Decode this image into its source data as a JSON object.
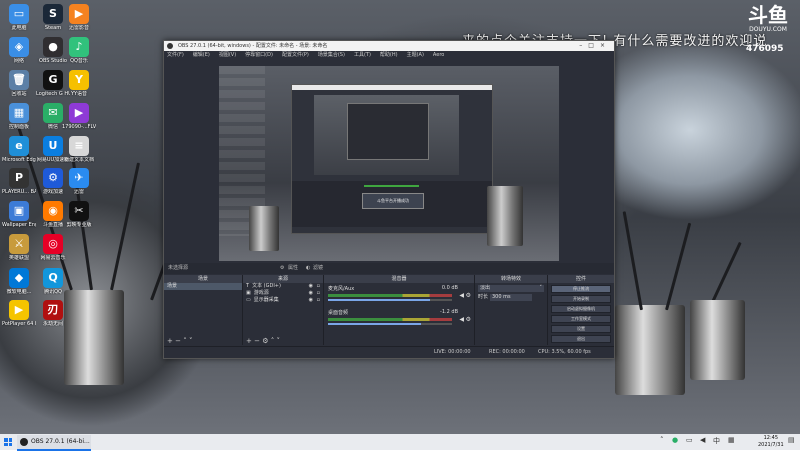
{
  "overlay": {
    "banner": "来的点个关注支持一下! 有什么需要改进的欢迎说",
    "logo_mark": "斗鱼",
    "logo_site": "DOUYU.COM",
    "room_id": "476095"
  },
  "desktop_icons": [
    {
      "label": "此电脑",
      "color": "#3a8ee6",
      "glyph": "▭"
    },
    {
      "label": "Steam",
      "color": "#1b2838",
      "glyph": "S"
    },
    {
      "label": "迅雷影音",
      "color": "#f58220",
      "glyph": "▶"
    },
    {
      "label": "网络",
      "color": "#3a8ee6",
      "glyph": "◈"
    },
    {
      "label": "OBS Studio",
      "color": "#302e31",
      "glyph": "●"
    },
    {
      "label": "QQ音乐",
      "color": "#31c27c",
      "glyph": "♪"
    },
    {
      "label": "回收站",
      "color": "#5b7fa6",
      "glyph": "🗑"
    },
    {
      "label": "Logitech G HUB",
      "color": "#111111",
      "glyph": "G"
    },
    {
      "label": "YY语音",
      "color": "#f6c000",
      "glyph": "Y"
    },
    {
      "label": "控制面板",
      "color": "#4a90d9",
      "glyph": "▦"
    },
    {
      "label": "微信",
      "color": "#2aae67",
      "glyph": "✉"
    },
    {
      "label": "179090-...FLV",
      "color": "#8e3ad6",
      "glyph": "▶"
    },
    {
      "label": "Microsoft Edge",
      "color": "#1f8fd8",
      "glyph": "e"
    },
    {
      "label": "网易UU加速器",
      "color": "#0a7ee0",
      "glyph": "U"
    },
    {
      "label": "新建文本文档",
      "color": "#d8d8d8",
      "glyph": "≡"
    },
    {
      "label": "PLAYERU... BATTLEGR...",
      "color": "#333333",
      "glyph": "P"
    },
    {
      "label": "游戏加速",
      "color": "#1e5ad8",
      "glyph": "⚙"
    },
    {
      "label": "迅雷",
      "color": "#2a8bf0",
      "glyph": "✈"
    },
    {
      "label": "Wallpaper Engine...",
      "color": "#3c7bd6",
      "glyph": "▣"
    },
    {
      "label": "斗鱼直播",
      "color": "#ff7a00",
      "glyph": "◉"
    },
    {
      "label": "剪映专业版",
      "color": "#111111",
      "glyph": "✂"
    },
    {
      "label": "英雄联盟",
      "color": "#c89b3c",
      "glyph": "⚔"
    },
    {
      "label": "网易云音乐",
      "color": "#e60026",
      "glyph": "◎"
    },
    {
      "label": "微软电脑...",
      "color": "#0078d7",
      "glyph": "◆"
    },
    {
      "label": "腾讯QQ",
      "color": "#1296db",
      "glyph": "Q"
    },
    {
      "label": "PotPlayer 64 bit",
      "color": "#f5c400",
      "glyph": "▶"
    },
    {
      "label": "永劫无间",
      "color": "#b01010",
      "glyph": "刃"
    }
  ],
  "obs": {
    "title": "OBS 27.0.1 (64-bit, windows) - 配置文件: 未命名 - 场景: 未命名",
    "menu": [
      "文件(F)",
      "编辑(E)",
      "视图(V)",
      "停靠窗口(D)",
      "配置文件(P)",
      "场景集合(S)",
      "工具(T)",
      "帮助(H)",
      "主题(A)",
      "Aero"
    ],
    "scene_toolbar": {
      "label": "未选择源",
      "props": "属性",
      "filters": "滤镜"
    },
    "preview_caption": "斗鱼平台开播成功",
    "docks": {
      "scenes": {
        "title": "场景",
        "items": [
          "场景"
        ]
      },
      "sources": {
        "title": "来源",
        "items": [
          {
            "name": "文本 (GDI+)",
            "icon": "T"
          },
          {
            "name": "游戏源",
            "icon": "▣"
          },
          {
            "name": "显示器采集",
            "icon": "▭"
          }
        ]
      },
      "mixer": {
        "title": "混音器",
        "channels": [
          {
            "name": "麦克风/Aux",
            "db": "0.0 dB",
            "level": 0.82
          },
          {
            "name": "桌面音频",
            "db": "-1.2 dB",
            "level": 0.75
          }
        ]
      },
      "transitions": {
        "title": "转场特效",
        "type": "淡出",
        "duration_label": "时长",
        "duration": "300 ms"
      },
      "controls": {
        "title": "控件",
        "buttons": [
          "停止推流",
          "开始录制",
          "启动虚拟摄像机",
          "工作室模式",
          "设置",
          "退出"
        ]
      }
    },
    "status": {
      "live": "LIVE: 00:00:00",
      "rec": "REC: 00:00:00",
      "cpu": "CPU: 3.5%, 60.00 fps"
    }
  },
  "taskbar": {
    "app_label": "OBS 27.0.1 (64-bi...",
    "time": "12:45",
    "date": "2021/7/31",
    "ime": "中"
  }
}
